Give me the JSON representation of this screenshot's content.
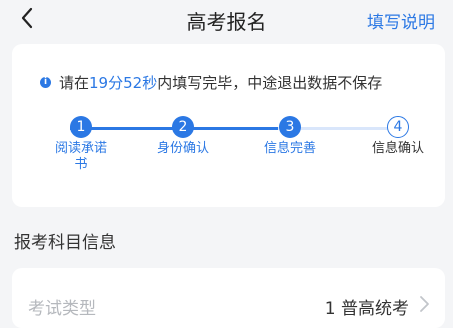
{
  "header": {
    "title": "高考报名",
    "help_label": "填写说明"
  },
  "notice": {
    "prefix": "请在",
    "time": "19分52秒",
    "suffix": "内填写完毕，中途退出数据不保存"
  },
  "steps": [
    {
      "number": "1",
      "label": "阅读承诺书",
      "state": "done"
    },
    {
      "number": "2",
      "label": "身份确认",
      "state": "done"
    },
    {
      "number": "3",
      "label": "信息完善",
      "state": "done"
    },
    {
      "number": "4",
      "label": "信息确认",
      "state": "todo"
    }
  ],
  "section": {
    "title": "报考科目信息"
  },
  "form_row": {
    "label": "考试类型",
    "value": "1 普高统考"
  },
  "colors": {
    "accent": "#2b78e4",
    "background": "#f4f5f7"
  }
}
